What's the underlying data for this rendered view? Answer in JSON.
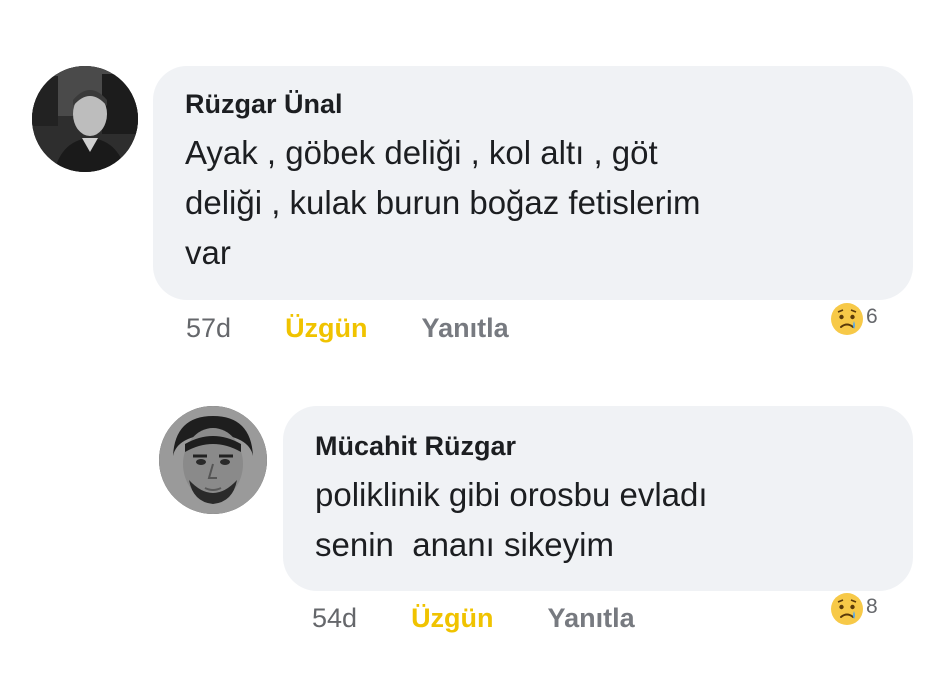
{
  "comments": [
    {
      "author": "Rüzgar Ünal",
      "lines": [
        "Ayak , göbek deliği , kol altı , göt",
        "deliği , kulak burun boğaz fetislerim",
        "var"
      ],
      "time": "57d",
      "reaction_label": "Üzgün",
      "reply_label": "Yanıtla",
      "reaction_count": "6",
      "reaction_icon": "sad-emoji-icon"
    },
    {
      "author": "Mücahit Rüzgar",
      "lines": [
        "poliklinik gibi orosbu evladı",
        "senin  ananı sikeyim"
      ],
      "time": "54d",
      "reaction_label": "Üzgün",
      "reply_label": "Yanıtla",
      "reaction_count": "8",
      "reaction_icon": "sad-emoji-icon"
    }
  ],
  "colors": {
    "bubble": "#f0f2f5",
    "reaction_sad": "#f0c300",
    "meta_gray": "#65676b"
  }
}
